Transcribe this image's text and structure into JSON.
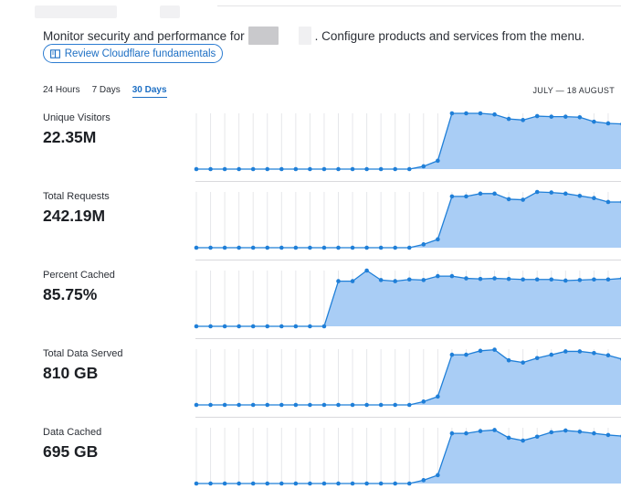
{
  "intro": {
    "prefix": "Monitor security and performance for",
    "suffix": ". Configure products and services from the menu."
  },
  "fundamentals_button": {
    "label": "Review Cloudflare fundamentals",
    "icon": "book-icon"
  },
  "time_tabs": [
    {
      "label": "24 Hours",
      "active": false
    },
    {
      "label": "7 Days",
      "active": false
    },
    {
      "label": "30 Days",
      "active": true
    }
  ],
  "date_range": "JULY — 18 AUGUST",
  "colors": {
    "accent": "#1d6fc4",
    "line": "#1f7fd8",
    "fill": "#a9cdf5",
    "grid": "#e6e7ea"
  },
  "metrics": [
    {
      "label": "Unique Visitors",
      "value": "22.35M",
      "series": [
        0,
        0,
        0,
        0,
        0,
        0,
        0,
        0,
        0,
        0,
        0,
        0,
        0,
        0,
        0,
        0,
        5,
        15,
        100,
        100,
        100,
        98,
        90,
        88,
        95,
        94,
        94,
        93,
        85,
        82,
        81
      ]
    },
    {
      "label": "Total Requests",
      "value": "242.19M",
      "series": [
        0,
        0,
        0,
        0,
        0,
        0,
        0,
        0,
        0,
        0,
        0,
        0,
        0,
        0,
        0,
        0,
        6,
        15,
        92,
        92,
        97,
        97,
        87,
        86,
        100,
        99,
        97,
        93,
        89,
        82,
        82
      ]
    },
    {
      "label": "Percent Cached",
      "value": "85.75%",
      "series": [
        0,
        0,
        0,
        0,
        0,
        0,
        0,
        0,
        0,
        0,
        81,
        81,
        100,
        83,
        81,
        84,
        83,
        90,
        90,
        86,
        85,
        86,
        85,
        84,
        84,
        84,
        82,
        83,
        84,
        84,
        86
      ]
    },
    {
      "label": "Total Data Served",
      "value": "810 GB",
      "series": [
        0,
        0,
        0,
        0,
        0,
        0,
        0,
        0,
        0,
        0,
        0,
        0,
        0,
        0,
        0,
        0,
        6,
        15,
        90,
        90,
        97,
        99,
        80,
        76,
        84,
        90,
        96,
        96,
        93,
        89,
        82
      ]
    },
    {
      "label": "Data Cached",
      "value": "695 GB",
      "series": [
        0,
        0,
        0,
        0,
        0,
        0,
        0,
        0,
        0,
        0,
        0,
        0,
        0,
        0,
        0,
        0,
        6,
        15,
        90,
        90,
        94,
        96,
        82,
        77,
        84,
        92,
        95,
        93,
        90,
        87,
        85
      ]
    }
  ]
}
